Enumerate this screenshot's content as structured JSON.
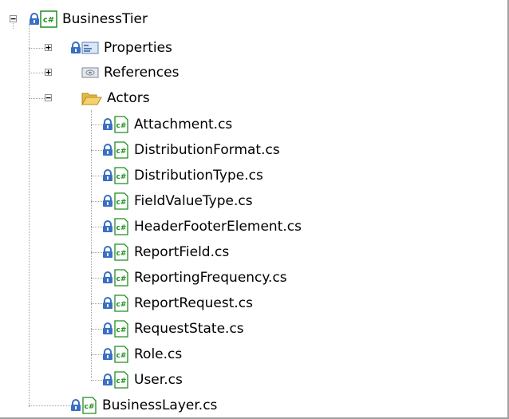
{
  "tree": {
    "root": {
      "label": "BusinessTier",
      "expander": "−"
    },
    "properties": {
      "label": "Properties",
      "expander": "+"
    },
    "references": {
      "label": "References",
      "expander": "+"
    },
    "actors": {
      "label": "Actors",
      "expander": "−",
      "files": [
        "Attachment.cs",
        "DistributionFormat.cs",
        "DistributionType.cs",
        "FieldValueType.cs",
        "HeaderFooterElement.cs",
        "ReportField.cs",
        "ReportingFrequency.cs",
        "ReportRequest.cs",
        "RequestState.cs",
        "Role.cs",
        "User.cs"
      ]
    },
    "business_layer": {
      "label": "BusinessLayer.cs"
    },
    "csharp_glyph": "c#"
  },
  "colors": {
    "lock": "#3a6fc4",
    "csharp_green": "#1f8f1f",
    "folder": "#f5d36b",
    "tree_lines": "#a0a0a0"
  }
}
